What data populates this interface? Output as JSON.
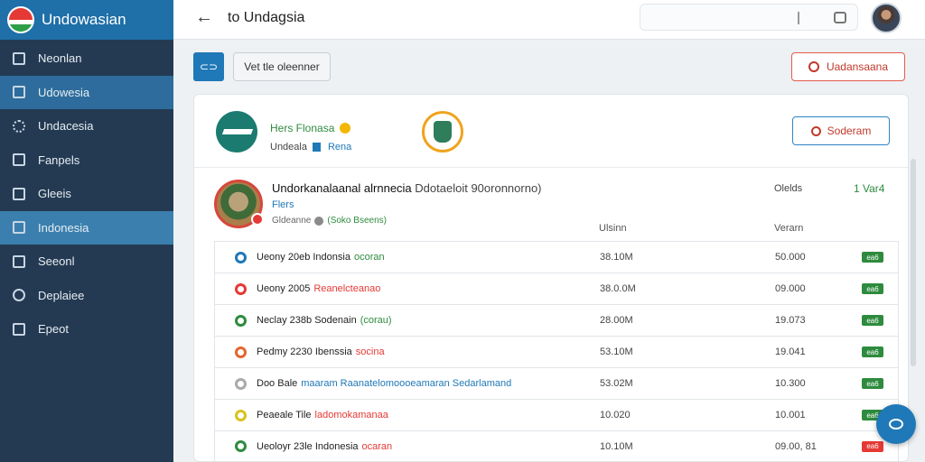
{
  "app": {
    "brand": "Undowasian",
    "title": "to Undagsia",
    "back_glyph": "←"
  },
  "sidebar": {
    "items": [
      {
        "label": "Neonlan",
        "icon": "document-icon"
      },
      {
        "label": "Udowesia",
        "icon": "grid-icon"
      },
      {
        "label": "Undacesia",
        "icon": "gear-icon"
      },
      {
        "label": "Fanpels",
        "icon": "document-icon"
      },
      {
        "label": "Gleeis",
        "icon": "box-icon"
      },
      {
        "label": "Indonesia",
        "icon": "panel-icon"
      },
      {
        "label": "Seeonl",
        "icon": "monitor-icon"
      },
      {
        "label": "Deplaiee",
        "icon": "search-icon"
      },
      {
        "label": "Epeot",
        "icon": "document-icon"
      }
    ]
  },
  "toolbar": {
    "icon_label": "⊂⊃",
    "filter_label": "Vet tle oleenner",
    "action_label": "Uadansaana"
  },
  "profile": {
    "name": "Hers Flonasa",
    "sub": "Undeala",
    "tag": "Rena",
    "button_label": "Soderam"
  },
  "org": {
    "title": "Undorkanalaanal alrnnecia",
    "title_tail": "Ddotaeloit  90oronnorno)",
    "link": "Flers",
    "meta": "Gldeanne",
    "meta_green": "(Soko Bseens)",
    "right_label": "Olelds",
    "right_value": "1 Var4"
  },
  "columns": {
    "usage": "Ulsinn",
    "value": "Verarn"
  },
  "rows": [
    {
      "name": "Ueony 20eb Indonsia",
      "tag": "ocoran",
      "tag_color": "#2e8b3e",
      "icon_color": "#1f78b8",
      "usage": "38.10M",
      "value": "50.000",
      "badge": "ea6",
      "badge_color": "#2e8b3e"
    },
    {
      "name": "Ueony 2005",
      "tag": "Reanelcteanao",
      "tag_color": "#e53935",
      "icon_color": "#e53935",
      "usage": "38.0.0M",
      "value": "09.000",
      "badge": "ea6",
      "badge_color": "#2e8b3e"
    },
    {
      "name": "Neclay 238b Sodenain",
      "tag": "(corau)",
      "tag_color": "#2e8b3e",
      "icon_color": "#2e8b3e",
      "usage": "28.00M",
      "value": "19.073",
      "badge": "ea6",
      "badge_color": "#2e8b3e"
    },
    {
      "name": "Pedmy 2230 Ibenssia",
      "tag": "socina",
      "tag_color": "#e53935",
      "icon_color": "#e5652e",
      "usage": "53.10M",
      "value": "19.041",
      "badge": "ea6",
      "badge_color": "#2e8b3e"
    },
    {
      "name": "Doo Bale",
      "tag": "maaram Raanatelomoooeamaran Sedarlamand",
      "tag_color": "#1f78b8",
      "icon_color": "#aaaaaa",
      "usage": "53.02M",
      "value": "10.300",
      "badge": "ea6",
      "badge_color": "#2e8b3e"
    },
    {
      "name": "Peaeale Tile",
      "tag": "ladomokamanaa",
      "tag_color": "#e53935",
      "icon_color": "#d9c21c",
      "usage": "10.020",
      "value": "10.001",
      "badge": "ea6",
      "badge_color": "#2e8b3e"
    },
    {
      "name": "Ueoloyr 23le Indonesia",
      "tag": "ocaran",
      "tag_color": "#e53935",
      "icon_color": "#2e8b3e",
      "usage": "10.10M",
      "value": "09.00, 81",
      "badge": "ea6",
      "badge_color": "#e53935"
    }
  ]
}
